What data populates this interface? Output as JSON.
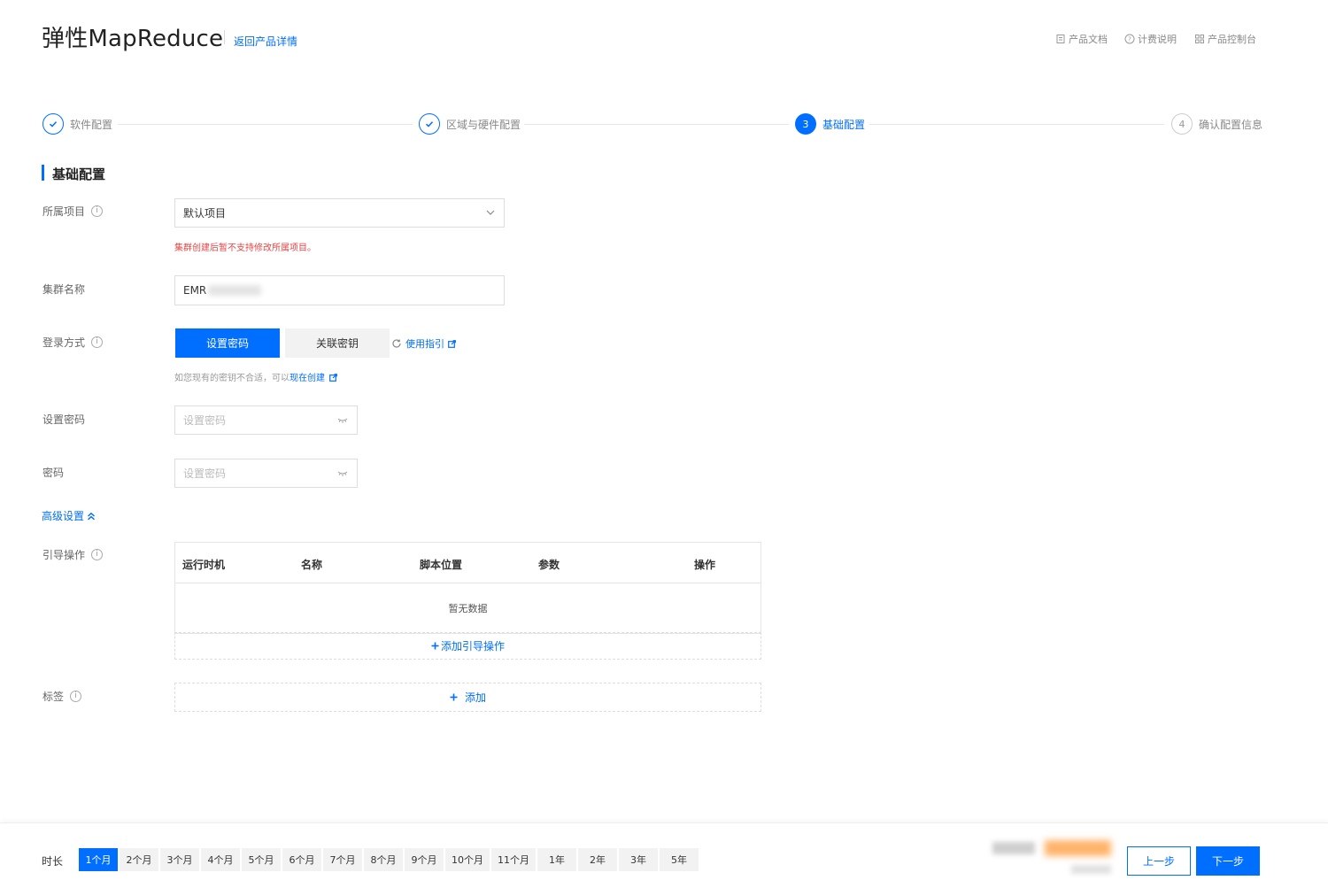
{
  "header": {
    "title": "弹性MapReduce",
    "back_link": "返回产品详情",
    "links": {
      "docs": "产品文档",
      "billing": "计费说明",
      "console": "产品控制台"
    }
  },
  "steps": [
    {
      "label": "软件配置",
      "status": "done"
    },
    {
      "label": "区域与硬件配置",
      "status": "done"
    },
    {
      "label": "基础配置",
      "number": "3",
      "status": "current"
    },
    {
      "label": "确认配置信息",
      "number": "4",
      "status": "todo"
    }
  ],
  "section": {
    "title": "基础配置"
  },
  "form": {
    "project": {
      "label": "所属项目",
      "value": "默认项目",
      "warning": "集群创建后暂不支持修改所属项目。"
    },
    "cluster_name": {
      "label": "集群名称",
      "value": "EMR"
    },
    "login": {
      "label": "登录方式",
      "options": [
        "设置密码",
        "关联密钥"
      ],
      "selected": "设置密码",
      "guide_link": "使用指引",
      "hint": "如您现有的密钥不合适，可以",
      "hint_link": "现在创建"
    },
    "set_password": {
      "label": "设置密码",
      "placeholder": "设置密码"
    },
    "password": {
      "label": "密码",
      "placeholder": "设置密码"
    },
    "advanced_link": "高级设置"
  },
  "bootstrap": {
    "label": "引导操作",
    "columns": [
      "运行时机",
      "名称",
      "脚本位置",
      "参数",
      "操作"
    ],
    "empty_text": "暂无数据",
    "add_label": "添加引导操作"
  },
  "tags": {
    "label": "标签",
    "add_label": "添加"
  },
  "footer": {
    "duration_label": "时长",
    "durations": [
      "1个月",
      "2个月",
      "3个月",
      "4个月",
      "5个月",
      "6个月",
      "7个月",
      "8个月",
      "9个月",
      "10个月",
      "11个月",
      "1年",
      "2年",
      "3年",
      "5年"
    ],
    "selected_duration": "1个月",
    "prev_label": "上一步",
    "next_label": "下一步"
  },
  "colors": {
    "accent": "#006eff",
    "warning": "#e54545"
  }
}
